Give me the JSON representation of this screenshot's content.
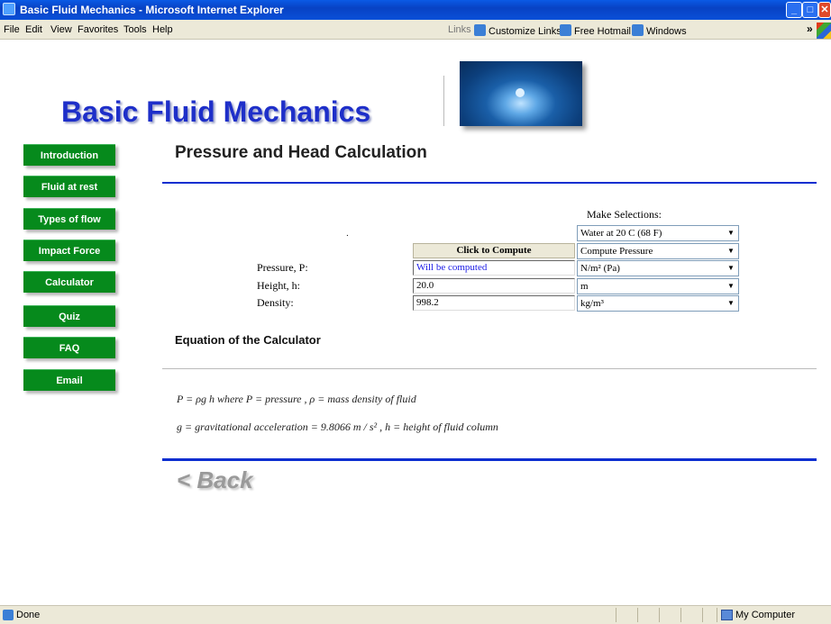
{
  "window": {
    "title": "Basic Fluid Mechanics - Microsoft Internet Explorer"
  },
  "menu": [
    "File",
    "Edit",
    "View",
    "Favorites",
    "Tools",
    "Help"
  ],
  "links_bar": {
    "label": "Links",
    "items": [
      "Customize Links",
      "Free Hotmail",
      "Windows"
    ]
  },
  "site": {
    "title": "Basic Fluid Mechanics"
  },
  "nav": [
    "Introduction",
    "Fluid at rest",
    "Types of flow",
    "Impact Force",
    "Calculator",
    "Quiz",
    "FAQ",
    "Email"
  ],
  "page": {
    "heading": "Pressure and Head Calculation"
  },
  "calculator": {
    "make_selections": "Make Selections:",
    "fluid_select": "Water at 20 C (68 F)",
    "compute_button": "Click to Compute",
    "mode_select": "Compute Pressure",
    "pressure": {
      "label": "Pressure, P:",
      "value": "Will be computed",
      "unit": "N/m² (Pa)"
    },
    "height": {
      "label": "Height, h:",
      "value": "20.0",
      "unit": "m"
    },
    "density": {
      "label": "Density:",
      "value": "998.2",
      "unit": "kg/m³"
    }
  },
  "equation": {
    "heading": "Equation of the Calculator",
    "line1": "P = ρg h              where P = pressure ,  ρ = mass density of fluid",
    "line2": "g = gravitational acceleration = 9.8066 m / s² ,  h = height of fluid column"
  },
  "back_link": "< Back",
  "status": {
    "left": "Done",
    "zone": "My Computer"
  },
  "colors": {
    "nav_green": "#068a1c",
    "title_blue": "#1e2fc9",
    "rule_blue": "#0b2ed0"
  }
}
